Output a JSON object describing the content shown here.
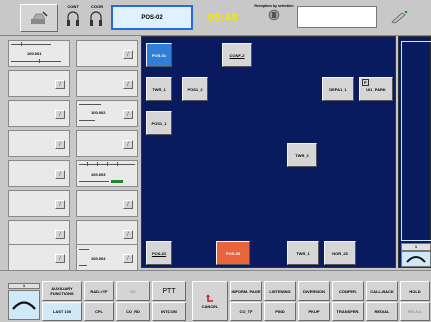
{
  "toolbar": {
    "cont_label": "CONT",
    "coor_label": "COOR",
    "position_name": "POS-02",
    "clock": "09:48",
    "reception_label": "Reception by selection"
  },
  "left_panel": {
    "entries": [
      {
        "number": "100.001",
        "col": 0,
        "row": 0
      },
      {
        "number": "100.002",
        "col": 1,
        "row": 2
      },
      {
        "number": "100.003",
        "col": 1,
        "row": 4
      },
      {
        "number": "100.004",
        "col": 1,
        "row": 7
      }
    ]
  },
  "main": {
    "tiles": [
      {
        "id": "POS-01",
        "style": "blue"
      },
      {
        "id": "CONF-2",
        "style": "ital"
      },
      {
        "id": "TWR_1",
        "style": "normal"
      },
      {
        "id": "POS1_2",
        "style": "normal"
      },
      {
        "id": "DEPA1_1",
        "style": "normal"
      },
      {
        "id": "UI1_PARK",
        "style": "normal",
        "badge": "P"
      },
      {
        "id": "POS1_1",
        "style": "normal"
      },
      {
        "id": "TWR_2",
        "style": "normal"
      },
      {
        "id": "POS-01",
        "style": "ital"
      },
      {
        "id": "POS-03",
        "style": "orange"
      },
      {
        "id": "TWR_1",
        "style": "normal"
      },
      {
        "id": "NOR_23",
        "style": "normal"
      }
    ]
  },
  "bottom": {
    "aux_top": "1",
    "aux_label": "AUXILIARY FUNCTIONS",
    "last_label": "LAST 100",
    "buttons_row1": [
      "RAD->TF",
      "SC",
      "PTT"
    ],
    "buttons_row2": [
      "CPL",
      "CO_RD",
      "INTCOM"
    ],
    "cancel_label": "CANCEL",
    "func_row1": [
      "INFORM. PAGE",
      "LISTENING",
      "DIVERSION",
      "CONFER.",
      "CALL-BACK",
      "HOLD"
    ],
    "func_row2": [
      "CO_TF",
      "PIND",
      "PKUP",
      "TRANSFER.",
      "REDIAL",
      "RELEA."
    ],
    "right_top": "1"
  },
  "colors": {
    "main_bg": "#0a1a5e",
    "accent_blue": "#2f7fd8",
    "active_orange": "#e8643a",
    "clock_yellow": "#f4e600",
    "light_blue_panel": "#cfe9f9"
  }
}
